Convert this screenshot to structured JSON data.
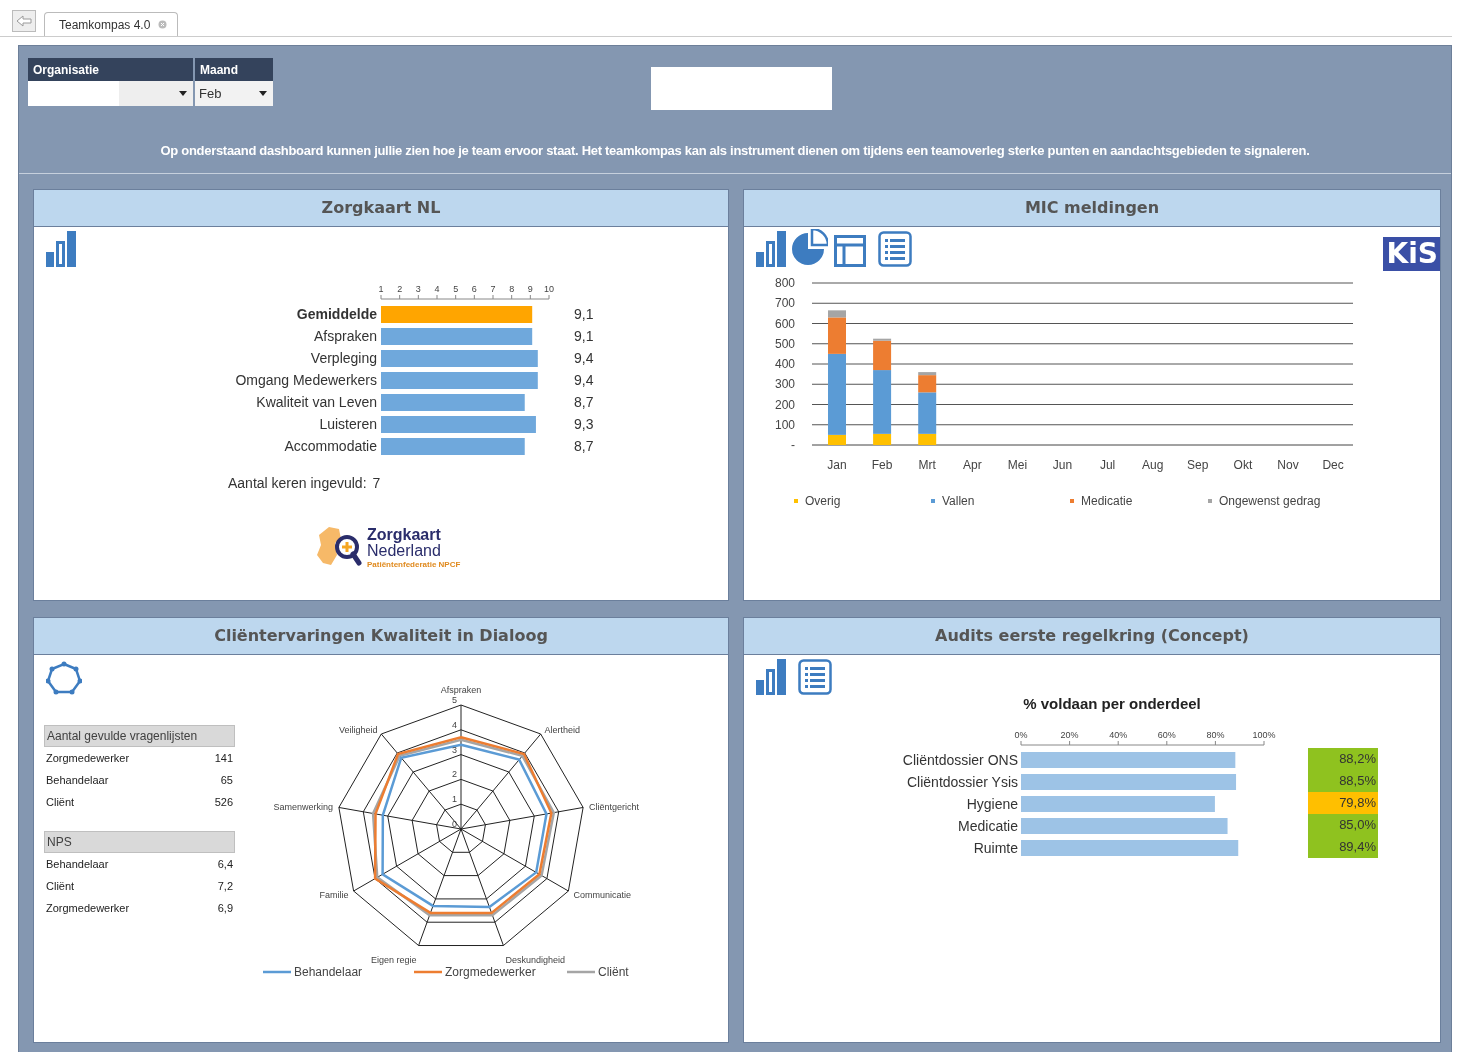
{
  "tab_strip": {
    "tabs": [
      {
        "label": "Teamkompas 4.0",
        "selected": true
      }
    ]
  },
  "filters": [
    {
      "label": "Organisatie"
    },
    {
      "label": "Maand",
      "value": "Feb"
    }
  ],
  "intro": "Op onderstaand dashboard kunnen jullie zien hoe je team ervoor staat. Het teamkompas kan als instrument dienen om tijdens een teamoverleg sterke punten en aandachtsgebieden te signaleren.",
  "panels": [
    {
      "kind": "zorgkaart",
      "title": "Zorgkaart NL",
      "chart_data": {
        "type": "bar",
        "orientation": "horizontal",
        "stacked": true,
        "categories": [
          "Gemiddelde",
          "Afspraken",
          "Verpleging",
          "Omgang Medewerkers",
          "Kwaliteit van Leven",
          "Luisteren",
          "Accommodatie"
        ],
        "series": [
          {
            "color": "#ffa500",
            "values": [
              9.1,
              null,
              null,
              null,
              null,
              null,
              null
            ]
          },
          {
            "color": "#6fa8dc",
            "values": [
              null,
              9.1,
              9.4,
              9.4,
              8.7,
              9.3,
              8.7
            ]
          }
        ],
        "xlim": [
          1,
          10
        ],
        "xticks": [
          1,
          2,
          3,
          4,
          5,
          6,
          7,
          8,
          9,
          10
        ],
        "value_labels": [
          "9,1",
          "9,1",
          "9,4",
          "9,4",
          "8,7",
          "9,3",
          "8,7"
        ]
      },
      "count_label": "Aantal keren ingevuld:",
      "count": "7",
      "logo": {
        "lines": [
          "Zorgkaart",
          "Nederland",
          "Patiëntenfederatie NPCF"
        ]
      }
    },
    {
      "kind": "mic",
      "title": "MIC meldingen",
      "badge": "KiS",
      "chart_data": {
        "type": "bar",
        "stacked": true,
        "categories": [
          "Jan",
          "Feb",
          "Mrt",
          "Apr",
          "Mei",
          "Jun",
          "Jul",
          "Aug",
          "Sep",
          "Okt",
          "Nov",
          "Dec"
        ],
        "series": [
          {
            "name": "Overig",
            "color": "#ffc000",
            "values": [
              50,
              55,
              55,
              null,
              null,
              null,
              null,
              null,
              null,
              null,
              null,
              null
            ]
          },
          {
            "name": "Vallen",
            "color": "#5b9bd5",
            "values": [
              400,
              315,
              205,
              null,
              null,
              null,
              null,
              null,
              null,
              null,
              null,
              null
            ]
          },
          {
            "name": "Medicatie",
            "color": "#ed7d31",
            "values": [
              180,
              145,
              85,
              null,
              null,
              null,
              null,
              null,
              null,
              null,
              null,
              null
            ]
          },
          {
            "name": "Ongewenst gedrag",
            "color": "#a5a5a5",
            "values": [
              35,
              10,
              15,
              null,
              null,
              null,
              null,
              null,
              null,
              null,
              null,
              null
            ]
          }
        ],
        "ylim": [
          0,
          800
        ],
        "yticks": [
          {
            "value": 0,
            "label": "-"
          },
          100,
          200,
          300,
          400,
          500,
          600,
          700,
          800
        ],
        "grid": true,
        "legend": true
      }
    },
    {
      "kind": "dialoog",
      "title": "Cliëntervaringen Kwaliteit in Dialoog",
      "tables": [
        {
          "title": "Aantal gevulde vragenlijsten",
          "rows": [
            {
              "label": "Zorgmedewerker",
              "value": "141"
            },
            {
              "label": "Behandelaar",
              "value": "65"
            },
            {
              "label": "Cliënt",
              "value": "526"
            }
          ]
        },
        {
          "title": "NPS",
          "rows": [
            {
              "label": "Behandelaar",
              "value": "6,4"
            },
            {
              "label": "Cliënt",
              "value": "7,2"
            },
            {
              "label": "Zorgmedewerker",
              "value": "6,9"
            }
          ]
        }
      ],
      "chart_data": {
        "type": "radar",
        "categories": [
          "Afspraken",
          "Alertheid",
          "Cliëntgericht",
          "Communicatie",
          "Deskundigheid",
          "Eigen regie",
          "Familie",
          "Samenwerking",
          "Veiligheid"
        ],
        "series": [
          {
            "name": "Behandelaar",
            "color": "#5b9bd5",
            "values": [
              3.4,
              3.65,
              3.5,
              3.5,
              3.35,
              3.3,
              3.65,
              3.2,
              3.75
            ]
          },
          {
            "name": "Zorgmedewerker",
            "color": "#ed7d31",
            "values": [
              3.7,
              3.95,
              3.7,
              3.65,
              3.6,
              3.6,
              4.0,
              3.5,
              3.95
            ]
          },
          {
            "name": "Cliënt",
            "color": "#a5a5a5",
            "values": [
              3.6,
              3.85,
              3.8,
              3.75,
              3.7,
              3.7,
              3.9,
              3.6,
              3.85
            ]
          }
        ],
        "ylim": [
          0,
          5
        ],
        "yticks": [
          0,
          1,
          2,
          3,
          4,
          5
        ],
        "legend": true
      }
    },
    {
      "kind": "audits",
      "title": "Audits eerste regelkring (Concept)",
      "chart_data": {
        "type": "bar",
        "orientation": "horizontal",
        "title": "% voldaan per onderdeel",
        "categories": [
          "Cliëntdossier ONS",
          "Cliëntdossier Ysis",
          "Hygiene",
          "Medicatie",
          "Ruimte"
        ],
        "values": [
          88.2,
          88.5,
          79.8,
          85.0,
          89.4
        ],
        "xlim": [
          0,
          100
        ],
        "xticks": [
          {
            "value": 0,
            "label": "0%"
          },
          {
            "value": 20,
            "label": "20%"
          },
          {
            "value": 40,
            "label": "40%"
          },
          {
            "value": 60,
            "label": "60%"
          },
          {
            "value": 80,
            "label": "80%"
          },
          {
            "value": 100,
            "label": "100%"
          }
        ]
      },
      "scores": [
        {
          "value": "88,2%",
          "color": "#8fc21f"
        },
        {
          "value": "88,5%",
          "color": "#8fc21f"
        },
        {
          "value": "79,8%",
          "color": "#ffbf00"
        },
        {
          "value": "85,0%",
          "color": "#8fc21f"
        },
        {
          "value": "89,4%",
          "color": "#8fc21f"
        }
      ]
    }
  ]
}
